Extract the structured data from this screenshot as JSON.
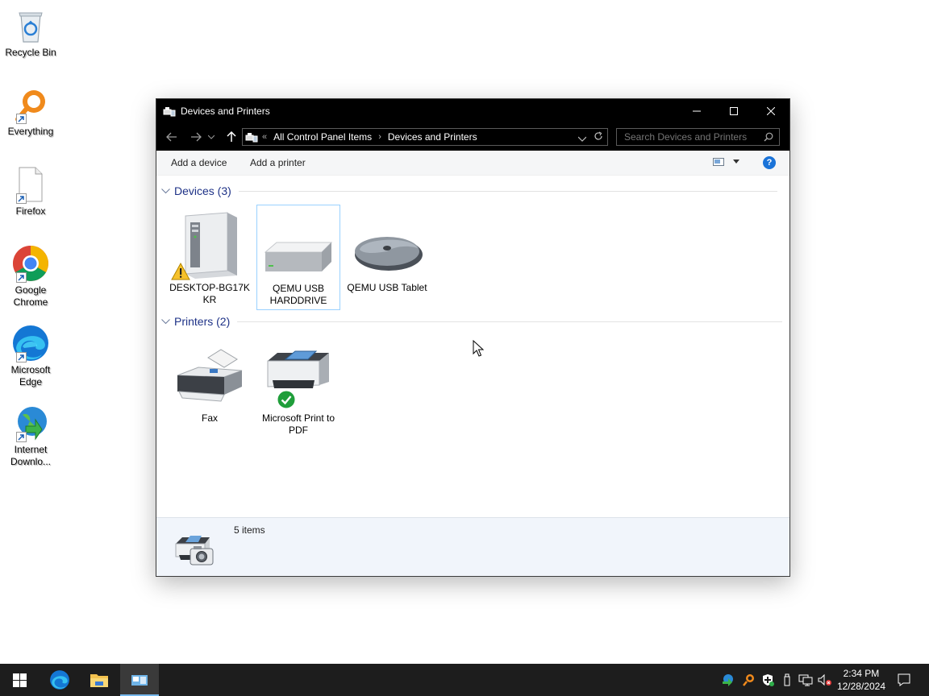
{
  "desktop": {
    "icons": [
      {
        "label": "Recycle Bin"
      },
      {
        "label": "Everything"
      },
      {
        "label": "Firefox"
      },
      {
        "label": "Google Chrome"
      },
      {
        "label": "Microsoft Edge"
      },
      {
        "label": "Internet Downlo..."
      }
    ]
  },
  "window": {
    "title": "Devices and Printers",
    "address": {
      "overflow": "«",
      "crumbs": [
        "All Control Panel Items",
        "Devices and Printers"
      ]
    },
    "search_placeholder": "Search Devices and Printers",
    "commands": {
      "add_device": "Add a device",
      "add_printer": "Add a printer",
      "help": "?"
    },
    "groups": [
      {
        "header": "Devices (3)",
        "items": [
          {
            "label": "DESKTOP-BG17K KR",
            "icon": "computer-icon",
            "badge": "warning"
          },
          {
            "label": "QEMU USB HARDDRIVE",
            "icon": "hard-drive-icon",
            "selected": true
          },
          {
            "label": "QEMU USB Tablet",
            "icon": "mouse-icon"
          }
        ]
      },
      {
        "header": "Printers (2)",
        "items": [
          {
            "label": "Fax",
            "icon": "fax-icon"
          },
          {
            "label": "Microsoft Print to PDF",
            "icon": "printer-icon",
            "badge": "default-check"
          }
        ]
      }
    ],
    "status": {
      "count": "5 items"
    }
  },
  "taskbar": {
    "time": "2:34 PM",
    "date": "12/28/2024"
  },
  "colors": {
    "group_header": "#1e3287",
    "titlebar": "#000000",
    "selection_border": "#99d1ff",
    "taskbar": "#1d1d1d"
  }
}
